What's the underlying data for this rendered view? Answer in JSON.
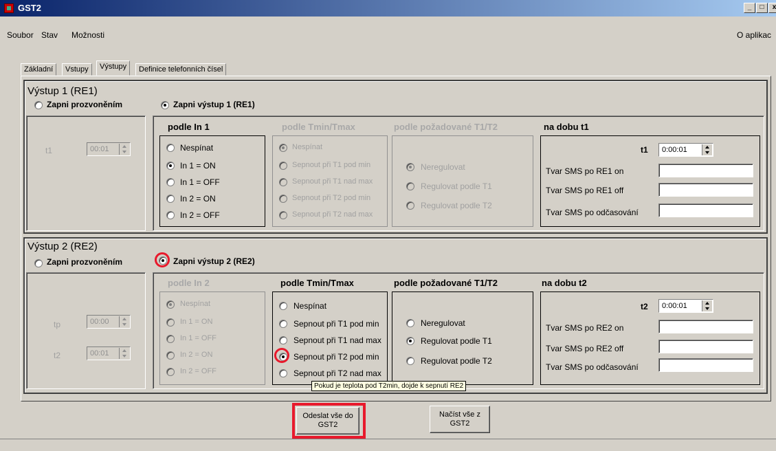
{
  "window": {
    "title": "GST2",
    "controls": {
      "min": "_",
      "max": "□",
      "close": "x"
    }
  },
  "menu": {
    "file": "Soubor",
    "state": "Stav",
    "options": "Možnosti",
    "about": "O aplikac"
  },
  "tabs": [
    "Základní",
    "Vstupy",
    "Výstupy",
    "Definice telefonních čísel"
  ],
  "out1": {
    "title": "Výstup 1 (RE1)",
    "mode_ring": "Zapni prozvoněním",
    "mode_on": "Zapni výstup 1 (RE1)",
    "t1_label": "t1",
    "t1_value": "00:01",
    "col_in": {
      "title": "podle In 1",
      "options": [
        "Nespínat",
        "In 1 = ON",
        "In 1 = OFF",
        "In 2 = ON",
        "In 2 = OFF"
      ]
    },
    "col_t": {
      "title": "podle Tmin/Tmax",
      "options": [
        "Nespínat",
        "Sepnout při T1 pod min",
        "Sepnout při T1 nad max",
        "Sepnout při T2 pod min",
        "Sepnout při T2 nad max"
      ]
    },
    "col_req": {
      "title": "podle požadované T1/T2",
      "options": [
        "Neregulovat",
        "Regulovat podle T1",
        "Regulovat podle T2"
      ]
    },
    "col_time": {
      "title": "na dobu t1",
      "t_label": "t1",
      "t_value": "0:00:01",
      "sms_on": "Tvar SMS po RE1 on",
      "sms_off": "Tvar SMS po RE1 off",
      "sms_end": "Tvar SMS po odčasování"
    }
  },
  "out2": {
    "title": "Výstup 2 (RE2)",
    "mode_ring": "Zapni prozvoněním",
    "mode_on": "Zapni výstup 2 (RE2)",
    "tp_label": "tp",
    "tp_value": "00:00",
    "t2_label": "t2",
    "t2_value": "00:01",
    "col_in": {
      "title": "podle In 2",
      "options": [
        "Nespínat",
        "In 1 = ON",
        "In 1 = OFF",
        "In 2 = ON",
        "In 2 = OFF"
      ]
    },
    "col_t": {
      "title": "podle Tmin/Tmax",
      "options": [
        "Nespínat",
        "Sepnout při T1 pod min",
        "Sepnout při T1 nad max",
        "Sepnout při T2 pod min",
        "Sepnout při T2 nad max"
      ]
    },
    "col_req": {
      "title": "podle požadované T1/T2",
      "options": [
        "Neregulovat",
        "Regulovat podle T1",
        "Regulovat podle T2"
      ]
    },
    "col_time": {
      "title": "na dobu t2",
      "t_label": "t2",
      "t_value": "0:00:01",
      "sms_on": "Tvar SMS po RE2 on",
      "sms_off": "Tvar SMS po RE2 off",
      "sms_end": "Tvar SMS po odčasování"
    }
  },
  "tooltip": "Pokud je teplota pod T2min, dojde k sepnutí RE2",
  "buttons": {
    "send": "Odeslat vše do GST2",
    "load": "Načíst vše z GST2"
  },
  "colors": {
    "highlight": "#e8192c",
    "title_bar": "#0a246a"
  }
}
